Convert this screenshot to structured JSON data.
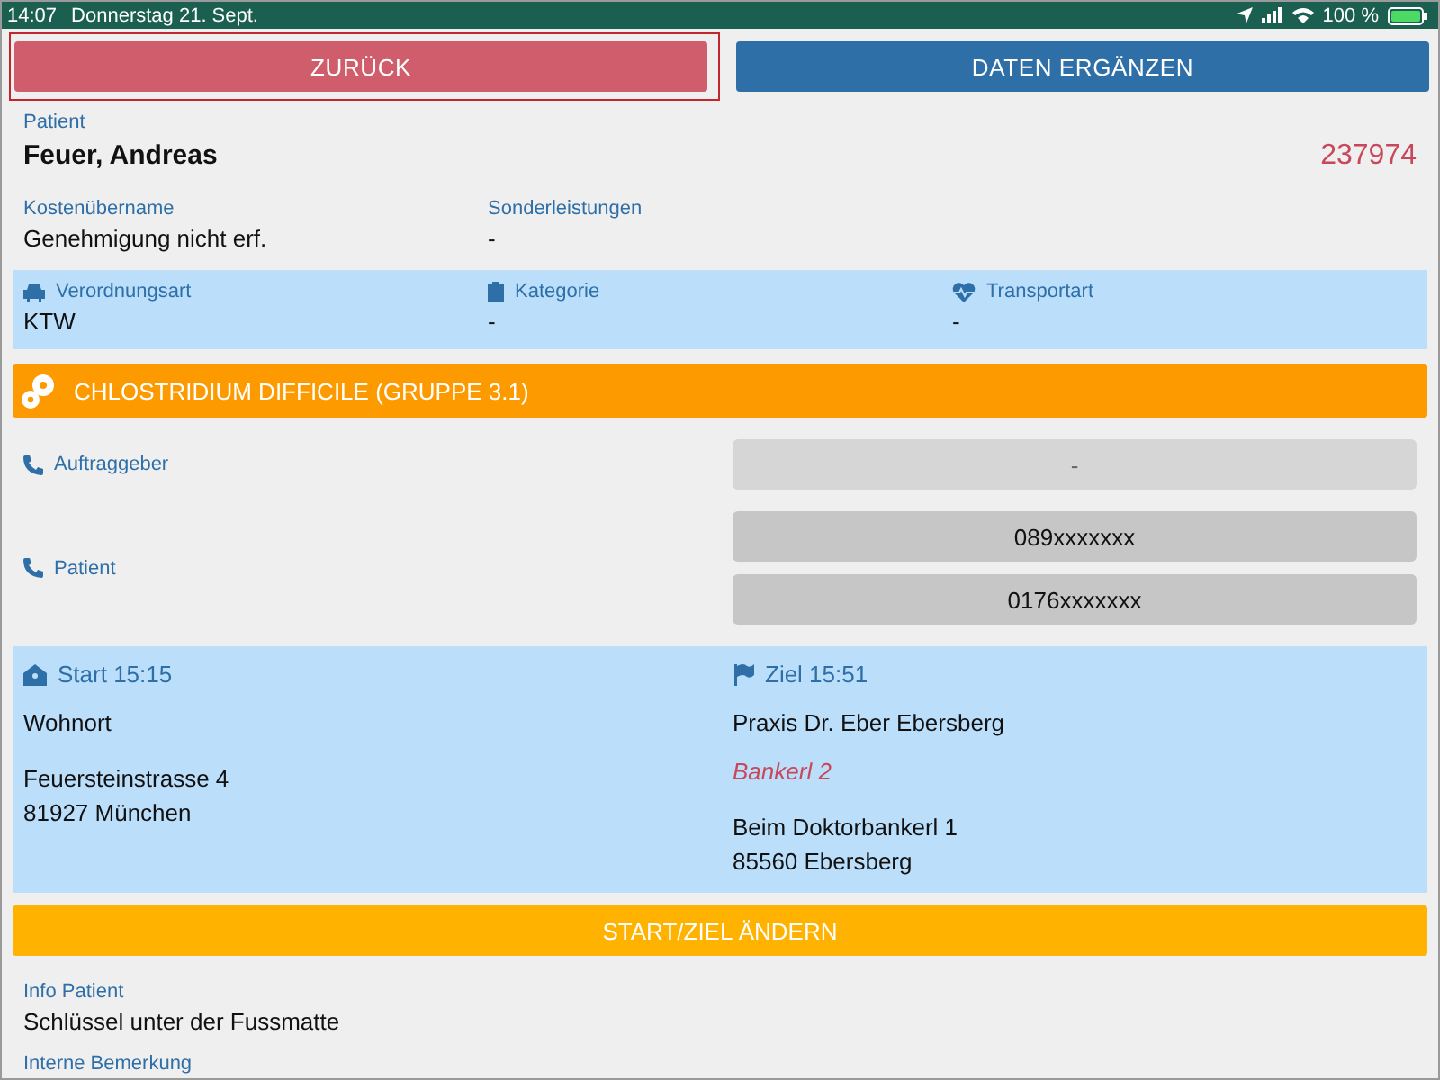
{
  "status_bar": {
    "time": "14:07",
    "date": "Donnerstag 21. Sept.",
    "battery": "100 %"
  },
  "buttons": [
    {
      "kind": "back",
      "label": "ZURÜCK",
      "focused": true
    },
    {
      "kind": "primary",
      "label": "DATEN ERGÄNZEN",
      "focused": false
    }
  ],
  "patient": {
    "label": "Patient",
    "name": "Feuer, Andreas",
    "number": "237974"
  },
  "billing": [
    {
      "label": "Kostenübername",
      "value": "Genehmigung nicht erf."
    },
    {
      "label": "Sonderleistungen",
      "value": "-"
    }
  ],
  "order_info": [
    {
      "kind": "car",
      "label": "Verordnungsart",
      "value": "KTW"
    },
    {
      "kind": "clipboard",
      "label": "Kategorie",
      "value": "-"
    },
    {
      "kind": "heart",
      "label": "Transportart",
      "value": "-"
    }
  ],
  "infection_banner": "CHLOSTRIDIUM DIFFICILE (GRUPPE 3.1)",
  "phones": [
    {
      "label": "Auftraggeber",
      "numbers": [
        {
          "value": "-",
          "disabled": true
        }
      ]
    },
    {
      "label": "Patient",
      "numbers": [
        {
          "value": "089xxxxxxx",
          "disabled": false
        },
        {
          "value": "0176xxxxxxx",
          "disabled": false
        }
      ]
    }
  ],
  "route": [
    {
      "kind": "home",
      "heading": "Start 15:15",
      "place": "Wohnort",
      "lines": [
        "Feuersteinstrasse 4",
        "81927 München"
      ]
    },
    {
      "kind": "flag",
      "heading": "Ziel 15:51",
      "place": "Praxis Dr. Eber Ebersberg",
      "note": "Bankerl 2",
      "lines": [
        "Beim Doktorbankerl 1",
        "85560 Ebersberg"
      ]
    }
  ],
  "change_button": "START/ZIEL ÄNDERN",
  "notes": [
    {
      "label": "Info Patient",
      "value": "Schlüssel unter der Fussmatte"
    },
    {
      "label": "Interne Bemerkung"
    }
  ]
}
